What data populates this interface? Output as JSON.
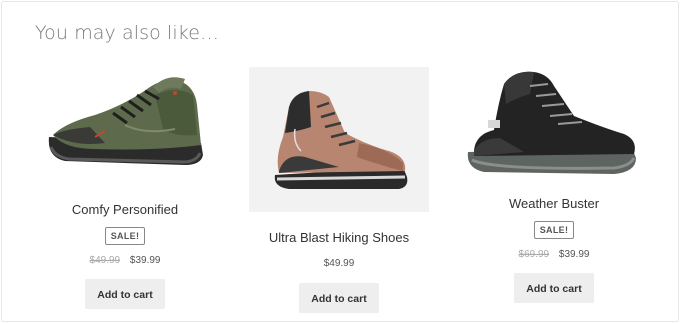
{
  "section": {
    "heading": "You may also like…"
  },
  "products": [
    {
      "name": "Comfy Personified",
      "badge": "SALE!",
      "old_price": "$49.99",
      "price": "$39.99",
      "button": "Add to cart",
      "image": "green-hiking-shoe"
    },
    {
      "name": "Ultra Blast Hiking Shoes",
      "price": "$49.99",
      "button": "Add to cart",
      "image": "brown-hiking-boot"
    },
    {
      "name": "Weather Buster",
      "badge": "SALE!",
      "old_price": "$69.99",
      "price": "$39.99",
      "button": "Add to cart",
      "image": "black-hiking-boot"
    }
  ]
}
